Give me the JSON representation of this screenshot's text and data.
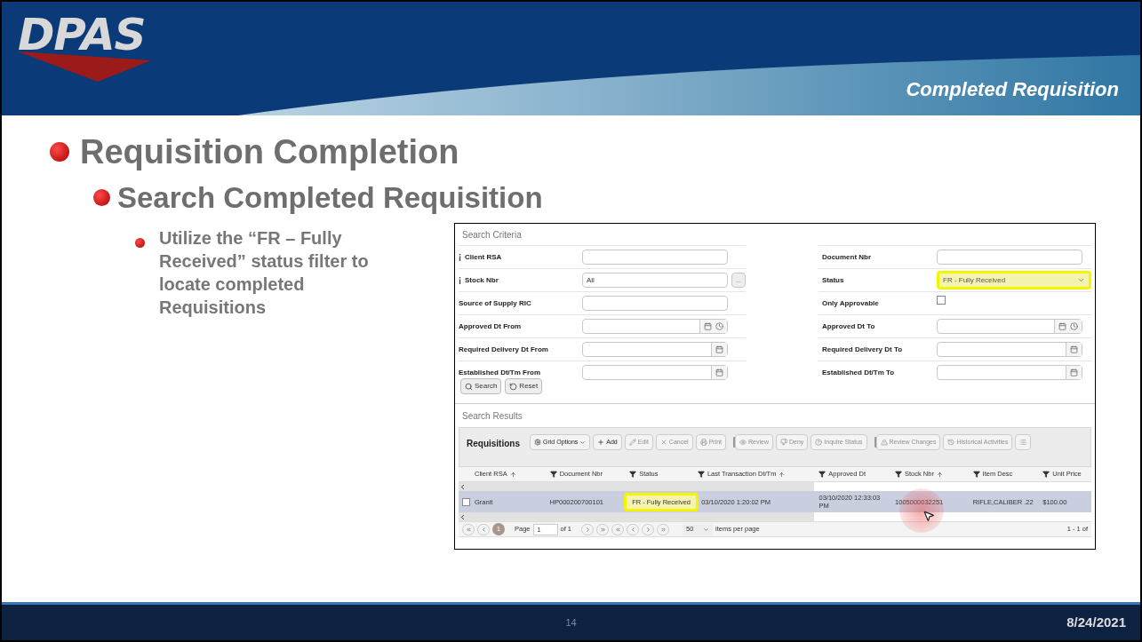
{
  "header": {
    "logo": "DPAS",
    "section_title": "Completed Requisition"
  },
  "bullets": [
    {
      "text": "Requisition Completion",
      "children": [
        {
          "text": "Search Completed Requisition",
          "children": [
            {
              "text": "Utilize the “FR – Fully Received” status filter to locate completed Requisitions"
            }
          ]
        }
      ]
    }
  ],
  "app": {
    "criteria_title": "Search Criteria",
    "fields_left": [
      {
        "label": "Client RSA",
        "info": true,
        "kind": "text"
      },
      {
        "label": "Stock Nbr",
        "info": true,
        "kind": "lookup",
        "value": "All",
        "lookup_button": "..."
      },
      {
        "label": "Source of Supply RIC",
        "info": false,
        "kind": "text"
      },
      {
        "label": "Approved Dt From",
        "info": false,
        "kind": "datetime"
      },
      {
        "label": "Required Delivery Dt From",
        "info": false,
        "kind": "date"
      },
      {
        "label": "Established Dt/Tm From",
        "info": false,
        "kind": "date"
      }
    ],
    "fields_right": [
      {
        "label": "Document Nbr",
        "kind": "text"
      },
      {
        "label": "Status",
        "kind": "select",
        "value": "FR - Fully Received",
        "highlighted": true
      },
      {
        "label": "Only Approvable",
        "kind": "checkbox",
        "checked": false
      },
      {
        "label": "Approved Dt To",
        "kind": "datetime"
      },
      {
        "label": "Required Delivery Dt To",
        "kind": "date"
      },
      {
        "label": "Established Dt/Tm To",
        "kind": "date"
      }
    ],
    "buttons": [
      {
        "label": "Search",
        "kind": "search"
      },
      {
        "label": "Reset",
        "kind": "reset"
      }
    ],
    "results_title": "Search Results",
    "grid_title": "Requisitions",
    "toolbar": [
      {
        "label": "Grid Options",
        "kind": "gear",
        "disabled": false,
        "dropdown": true,
        "separator_before": false
      },
      {
        "label": "Add",
        "kind": "plus",
        "disabled": false,
        "dropdown": false,
        "separator_before": false
      },
      {
        "label": "Edit",
        "kind": "pencil",
        "disabled": true,
        "dropdown": false,
        "separator_before": false
      },
      {
        "label": "Cancel",
        "kind": "x",
        "disabled": true,
        "dropdown": false,
        "separator_before": false
      },
      {
        "label": "Print",
        "kind": "printer",
        "disabled": true,
        "dropdown": false,
        "separator_before": false
      },
      {
        "label": "Review",
        "kind": "eye",
        "disabled": true,
        "dropdown": false,
        "separator_before": true
      },
      {
        "label": "Deny",
        "kind": "thumb",
        "disabled": true,
        "dropdown": false,
        "separator_before": false
      },
      {
        "label": "Inquire Status",
        "kind": "question",
        "disabled": true,
        "dropdown": false,
        "separator_before": false
      },
      {
        "label": "Review Changes",
        "kind": "warning",
        "disabled": true,
        "dropdown": false,
        "separator_before": true
      },
      {
        "label": "Historical Activities",
        "kind": "history",
        "disabled": true,
        "dropdown": false,
        "separator_before": false
      },
      {
        "kind": "list",
        "disabled": true,
        "dropdown": false,
        "separator_before": false
      }
    ],
    "columns": [
      {
        "label": "Client RSA",
        "sorted": true,
        "filter": false
      },
      {
        "label": "Document Nbr",
        "sorted": false,
        "filter": true
      },
      {
        "label": "Status",
        "sorted": false,
        "filter": true
      },
      {
        "label": "Last Transaction Dt/Tm",
        "sorted": true,
        "filter": true
      },
      {
        "label": "Approved Dt",
        "sorted": false,
        "filter": true
      },
      {
        "label": "Stock Nbr",
        "sorted": true,
        "filter": true
      },
      {
        "label": "Item Desc",
        "sorted": false,
        "filter": true
      },
      {
        "label": "Unit Price",
        "sorted": false,
        "filter": true
      }
    ],
    "rows": [
      {
        "selected": true,
        "checked": false,
        "cells": [
          {
            "text": "Granit",
            "highlighted": false
          },
          {
            "text": "HP000200700101",
            "highlighted": false
          },
          {
            "text": "FR - Fully Received",
            "highlighted": true
          },
          {
            "text": "03/10/2020 1:20:02 PM",
            "highlighted": false
          },
          {
            "text": "03/10/2020 12:33:03 PM",
            "highlighted": false
          },
          {
            "text": "1005000032251",
            "highlighted": false
          },
          {
            "text": "RIFLE,CALIBER .22",
            "highlighted": false
          },
          {
            "text": "$100.00",
            "highlighted": false
          }
        ]
      }
    ],
    "pager": {
      "current_page": "1",
      "page_label": "Page",
      "page_input": "1",
      "of_label": "of 1",
      "page_size": "50",
      "page_size_label": "items per page",
      "range": "1 - 1 of"
    }
  },
  "footer": {
    "page_number": "14",
    "date": "8/24/2021"
  }
}
